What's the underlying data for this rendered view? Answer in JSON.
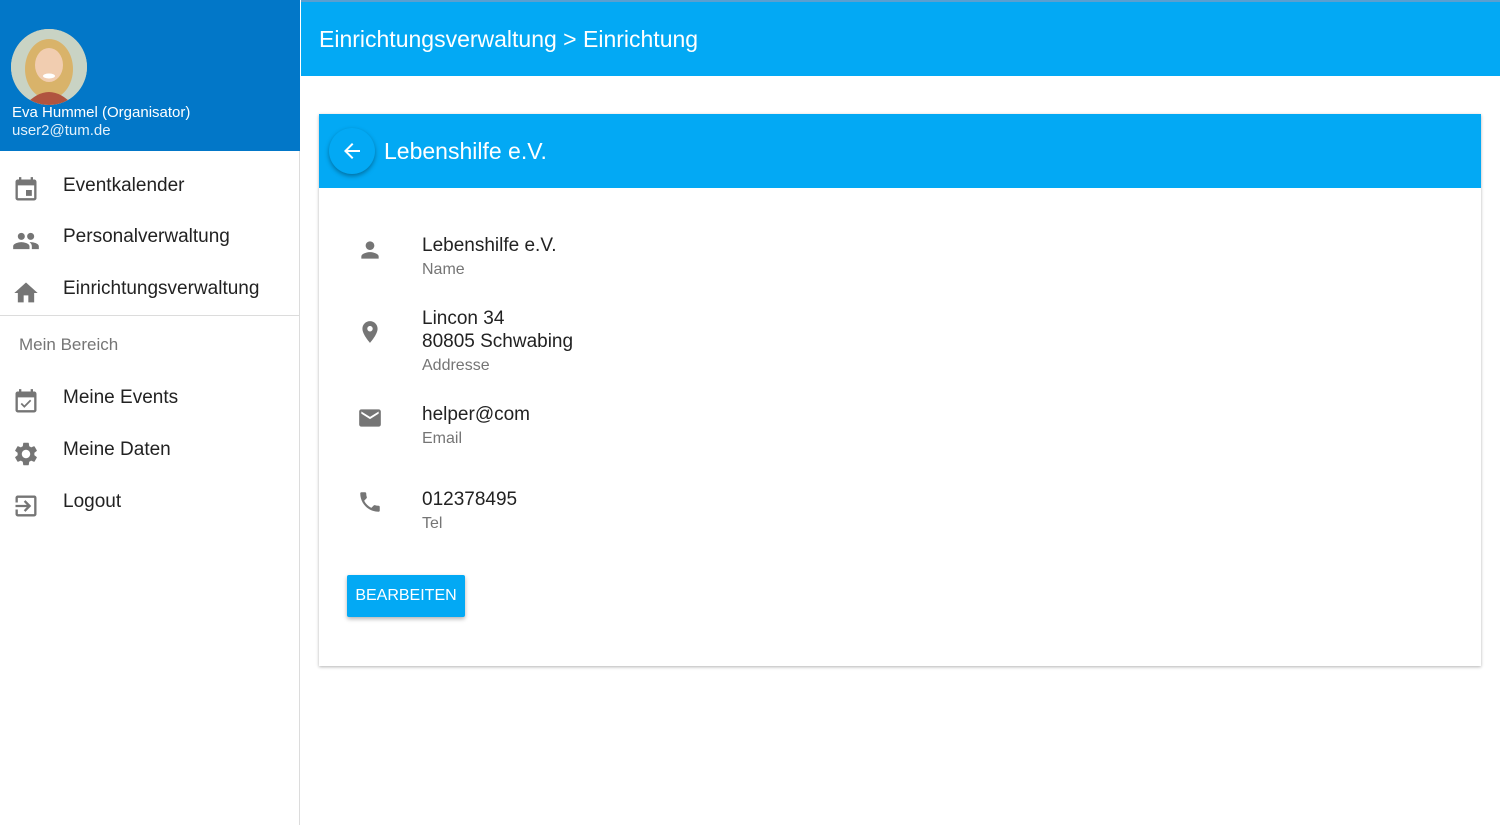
{
  "profile": {
    "name": "Eva Hummel (Organisator)",
    "email": "user2@tum.de"
  },
  "nav": {
    "items": [
      {
        "label": "Eventkalender",
        "icon": "calendar-icon"
      },
      {
        "label": "Personalverwaltung",
        "icon": "people-icon"
      },
      {
        "label": "Einrichtungsverwaltung",
        "icon": "home-icon"
      }
    ],
    "section_title": "Mein Bereich",
    "my_items": [
      {
        "label": "Meine Events",
        "icon": "calendar-check-icon"
      },
      {
        "label": "Meine Daten",
        "icon": "gear-icon"
      },
      {
        "label": "Logout",
        "icon": "logout-icon"
      }
    ]
  },
  "header": {
    "title": "Einrichtungsverwaltung > Einrichtung"
  },
  "card": {
    "title": "Lebenshilfe e.V.",
    "fields": {
      "name": {
        "value": "Lebenshilfe e.V.",
        "label": "Name"
      },
      "address": {
        "line1": "Lincon 34",
        "line2": "80805 Schwabing",
        "label": "Addresse"
      },
      "email": {
        "value": "helper@com",
        "label": "Email"
      },
      "tel": {
        "value": "012378495",
        "label": "Tel"
      }
    },
    "edit_label": "BEARBEITEN"
  },
  "colors": {
    "primary": "#03a9f4",
    "profile_bg": "#0277c8",
    "icon_grey": "#757575"
  }
}
